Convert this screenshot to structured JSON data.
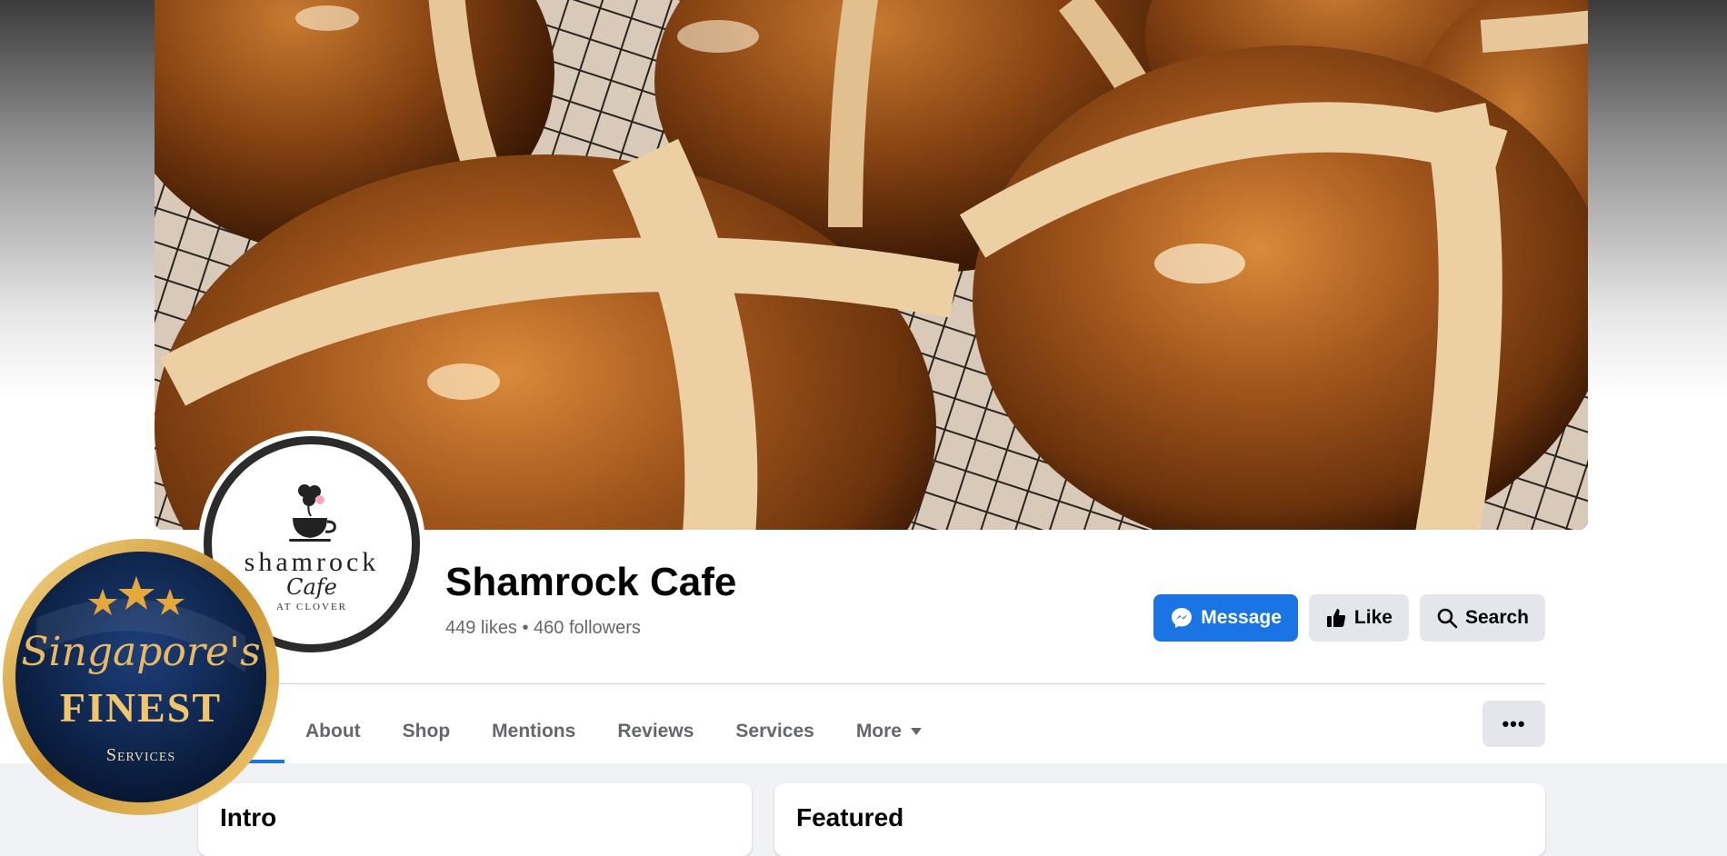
{
  "page": {
    "name": "Shamrock Cafe",
    "stats": "449 likes • 460 followers"
  },
  "logo": {
    "word": "shamrock",
    "script": "Cafe",
    "sub": "AT CLOVER"
  },
  "actions": {
    "message_label": "Message",
    "like_label": "Like",
    "search_label": "Search"
  },
  "tabs": [
    {
      "label": "About"
    },
    {
      "label": "Shop"
    },
    {
      "label": "Mentions"
    },
    {
      "label": "Reviews"
    },
    {
      "label": "Services"
    },
    {
      "label": "More"
    }
  ],
  "cards": {
    "intro_title": "Intro",
    "featured_title": "Featured"
  },
  "badge": {
    "line1": "Singapore's",
    "line2": "FINEST",
    "line3": "Services"
  },
  "colors": {
    "accent": "#1b74e4",
    "button_gray": "#e4e6eb",
    "secondary_text": "#65676b"
  },
  "icons": {
    "message": "messenger-icon",
    "like": "thumbs-up-icon",
    "search": "search-icon",
    "more": "caret-down-icon",
    "overflow": "ellipsis-icon"
  }
}
